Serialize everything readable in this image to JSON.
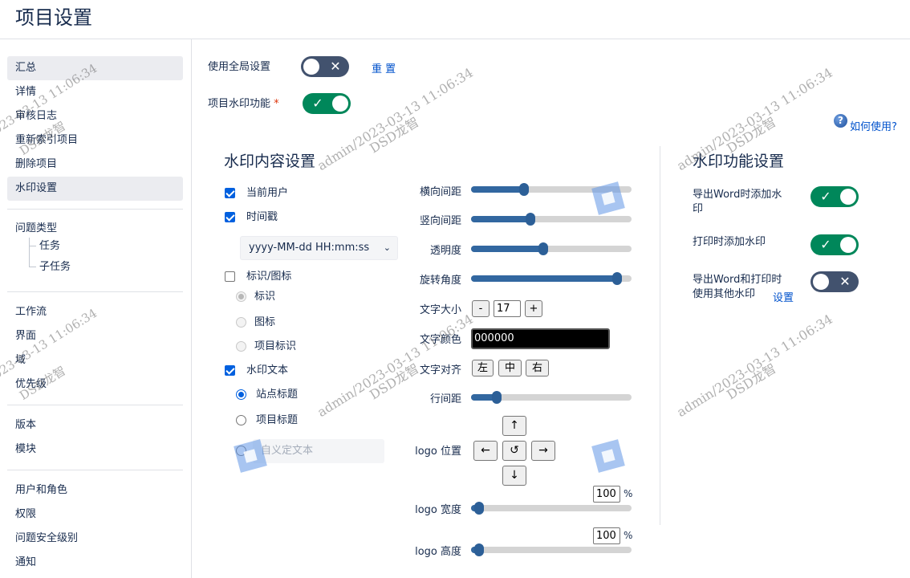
{
  "page": {
    "title": "项目设置"
  },
  "sidebar": {
    "group1": [
      "汇总",
      "详情",
      "审核日志",
      "重新索引项目",
      "删除项目",
      "水印设置"
    ],
    "issue_types": {
      "label": "问题类型",
      "children": [
        "任务",
        "子任务"
      ]
    },
    "group3": [
      "工作流",
      "界面",
      "域",
      "优先级"
    ],
    "group4": [
      "版本",
      "模块"
    ],
    "group5": [
      "用户和角色",
      "权限",
      "问题安全级别",
      "通知"
    ]
  },
  "top": {
    "use_global_label": "使用全局设置",
    "use_global_on": false,
    "reset_label": "重 置",
    "project_wm_label": "项目水印功能",
    "required_mark": "*",
    "project_wm_on": true,
    "help_label": "如何使用?"
  },
  "content": {
    "title": "水印内容设置",
    "current_user": {
      "label": "当前用户",
      "checked": true
    },
    "timestamp": {
      "label": "时间戳",
      "checked": true
    },
    "date_format": "yyyy-MM-dd HH:mm:ss",
    "logo": {
      "label": "标识/图标",
      "checked": false
    },
    "logo_options": [
      "标识",
      "图标",
      "项目标识"
    ],
    "wm_text": {
      "label": "水印文本",
      "checked": true
    },
    "text_options": [
      "站点标题",
      "项目标题"
    ],
    "custom_text_placeholder": "自义定文本"
  },
  "controls": {
    "h_spacing": {
      "label": "横向间距",
      "value": 0.33
    },
    "v_spacing": {
      "label": "竖向间距",
      "value": 0.37
    },
    "opacity": {
      "label": "透明度",
      "value": 0.45
    },
    "rotation": {
      "label": "旋转角度",
      "value": 0.91
    },
    "font_size": {
      "label": "文字大小",
      "value": "17",
      "minus": "-",
      "plus": "+"
    },
    "font_color": {
      "label": "文字颜色",
      "value": "000000"
    },
    "align": {
      "label": "文字对齐",
      "options": [
        "左",
        "中",
        "右"
      ]
    },
    "line_spacing": {
      "label": "行间距",
      "value": 0.16
    },
    "logo_pos": {
      "label": "logo 位置",
      "up": "↑",
      "left": "←",
      "reset": "↺",
      "right": "→",
      "down": "↓"
    },
    "logo_width": {
      "label": "logo 宽度",
      "value": "100",
      "unit": "%",
      "slider": 0.05
    },
    "logo_height": {
      "label": "logo 高度",
      "value": "100",
      "unit": "%",
      "slider": 0.05
    }
  },
  "features": {
    "title": "水印功能设置",
    "export_word": {
      "label_line1": "导出Word时添加水",
      "label_line2": "印",
      "on": true
    },
    "print": {
      "label": "打印时添加水印",
      "on": true
    },
    "other": {
      "label_line1": "导出Word和打印时",
      "label_line2": "使用其他水印",
      "link": "设置",
      "on": false
    }
  },
  "watermark": {
    "time": "2023-03-13 11:06:34",
    "user_time": "admin/2023-03-13 11:06:34",
    "name": "DSD龙智"
  },
  "colors": {
    "accent": "#0052cc",
    "toggle_on": "#00875a",
    "toggle_off": "#42526e",
    "slider": "#3267a0"
  }
}
